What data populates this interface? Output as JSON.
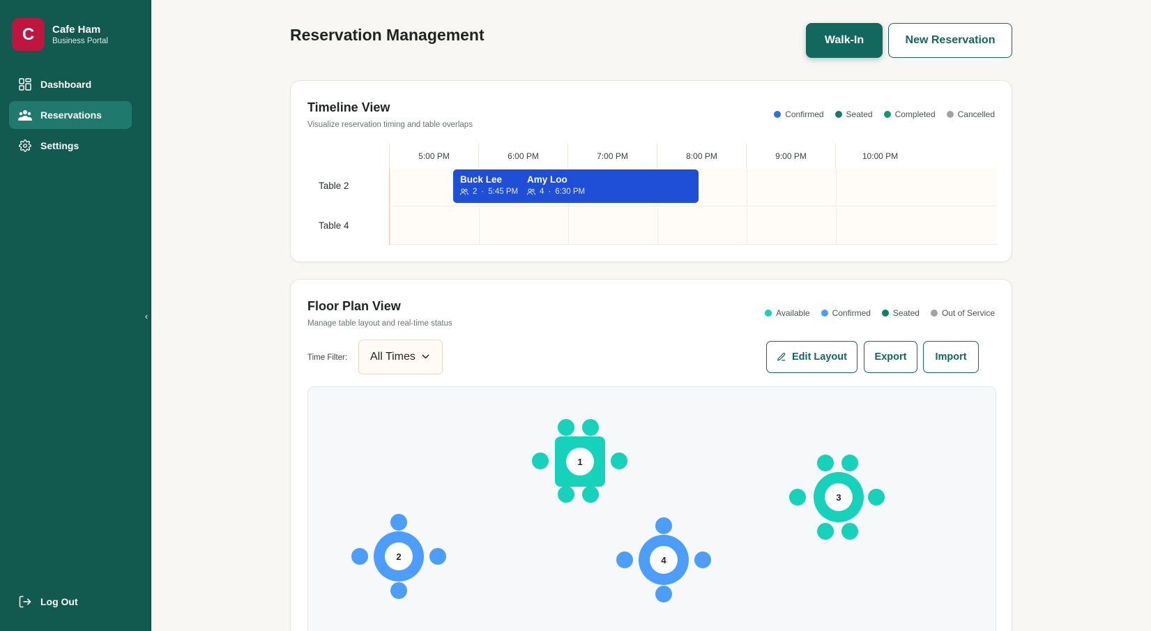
{
  "brand": {
    "logo_letter": "C",
    "name": "Cafe Ham",
    "subtitle": "Business Portal",
    "color": "#c0153e"
  },
  "sidebar": {
    "items": [
      {
        "label": "Dashboard",
        "icon": "dashboard-grid-icon",
        "active": false
      },
      {
        "label": "Reservations",
        "icon": "people-icon",
        "active": true
      },
      {
        "label": "Settings",
        "icon": "gear-icon",
        "active": false
      }
    ],
    "logout_label": "Log Out",
    "collapse_glyph": "‹"
  },
  "header": {
    "title": "Reservation Management",
    "walkin_label": "Walk-In",
    "new_reservation_label": "New Reservation"
  },
  "timeline": {
    "title": "Timeline View",
    "subtitle": "Visualize reservation timing and table overlaps",
    "legend": [
      {
        "label": "Confirmed",
        "color": "#2f6fe8"
      },
      {
        "label": "Seated",
        "color": "#0f7d6d"
      },
      {
        "label": "Completed",
        "color": "#0e9a6e"
      },
      {
        "label": "Cancelled",
        "color": "#a3a3a3"
      }
    ],
    "hours": [
      "5:00 PM",
      "6:00 PM",
      "7:00 PM",
      "8:00 PM",
      "9:00 PM",
      "10:00 PM"
    ],
    "tables": [
      "Table 2",
      "Table 4"
    ],
    "reservations": [
      {
        "name": "Buck Lee",
        "party": "2",
        "time": "5:45 PM"
      },
      {
        "name": "Amy Loo",
        "party": "4",
        "time": "6:30 PM"
      }
    ],
    "block_color": "#1e4fd6"
  },
  "floor": {
    "title": "Floor Plan View",
    "subtitle": "Manage table layout and real-time status",
    "legend": [
      {
        "label": "Available",
        "color": "#14d3ba"
      },
      {
        "label": "Confirmed",
        "color": "#4b9efb"
      },
      {
        "label": "Seated",
        "color": "#0f7d6d"
      },
      {
        "label": "Out of Service",
        "color": "#a3a3a3"
      }
    ],
    "time_filter_label": "Time Filter:",
    "time_filter_value": "All Times",
    "edit_layout_label": "Edit Layout",
    "export_label": "Export",
    "import_label": "Import",
    "tables": [
      {
        "number": "1",
        "shape": "square",
        "status": "Available"
      },
      {
        "number": "2",
        "shape": "round",
        "status": "Confirmed"
      },
      {
        "number": "3",
        "shape": "round",
        "status": "Available"
      },
      {
        "number": "4",
        "shape": "round",
        "status": "Confirmed"
      }
    ]
  }
}
